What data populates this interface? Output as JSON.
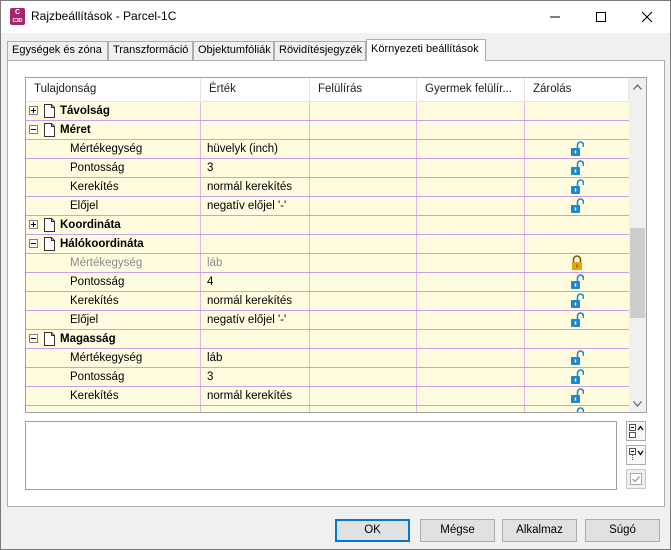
{
  "window": {
    "title": "Rajzbeállítások - Parcel-1C",
    "icon_text": "C\nC3D"
  },
  "tabs": [
    {
      "label": "Egységek és zóna",
      "active": false
    },
    {
      "label": "Transzformáció",
      "active": false
    },
    {
      "label": "Objektumfóliák",
      "active": false
    },
    {
      "label": "Rövidítésjegyzék",
      "active": false
    },
    {
      "label": "Környezeti beállítások",
      "active": true
    }
  ],
  "grid": {
    "columns": [
      "Tulajdonság",
      "Érték",
      "Felülírás",
      "Gyermek felülír...",
      "Zárolás"
    ],
    "rows": [
      {
        "type": "group",
        "expanded": false,
        "label": "Távolság"
      },
      {
        "type": "group",
        "expanded": true,
        "label": "Méret"
      },
      {
        "type": "prop",
        "label": "Mértékegység",
        "value": "hüvelyk (inch)",
        "lock": "unlocked"
      },
      {
        "type": "prop",
        "label": "Pontosság",
        "value": "3",
        "lock": "unlocked"
      },
      {
        "type": "prop",
        "label": "Kerekítés",
        "value": "normál kerekítés",
        "lock": "unlocked"
      },
      {
        "type": "prop",
        "label": "Előjel",
        "value": "negatív előjel '-'",
        "lock": "unlocked"
      },
      {
        "type": "group",
        "expanded": false,
        "label": "Koordináta"
      },
      {
        "type": "group",
        "expanded": true,
        "label": "Hálókoordináta"
      },
      {
        "type": "prop",
        "label": "Mértékegység",
        "value": "láb",
        "lock": "locked",
        "dim": true
      },
      {
        "type": "prop",
        "label": "Pontosság",
        "value": "4",
        "lock": "unlocked"
      },
      {
        "type": "prop",
        "label": "Kerekítés",
        "value": "normál kerekítés",
        "lock": "unlocked"
      },
      {
        "type": "prop",
        "label": "Előjel",
        "value": "negatív előjel '-'",
        "lock": "unlocked"
      },
      {
        "type": "group",
        "expanded": true,
        "label": "Magasság"
      },
      {
        "type": "prop",
        "label": "Mértékegység",
        "value": "láb",
        "lock": "unlocked"
      },
      {
        "type": "prop",
        "label": "Pontosság",
        "value": "3",
        "lock": "unlocked"
      },
      {
        "type": "prop",
        "label": "Kerekítés",
        "value": "normál kerekítés",
        "lock": "unlocked"
      },
      {
        "type": "prop",
        "label": "",
        "value": "",
        "lock": "unlocked"
      }
    ]
  },
  "buttons": {
    "ok": "OK",
    "cancel": "Mégse",
    "apply": "Alkalmaz",
    "help": "Súgó"
  },
  "colors": {
    "row_bg": "#fffbde",
    "row_border": "#c8a0e6",
    "lock_unlocked": "#1e88c8",
    "lock_locked": "#e8a400",
    "app_icon": "#a6266e"
  }
}
